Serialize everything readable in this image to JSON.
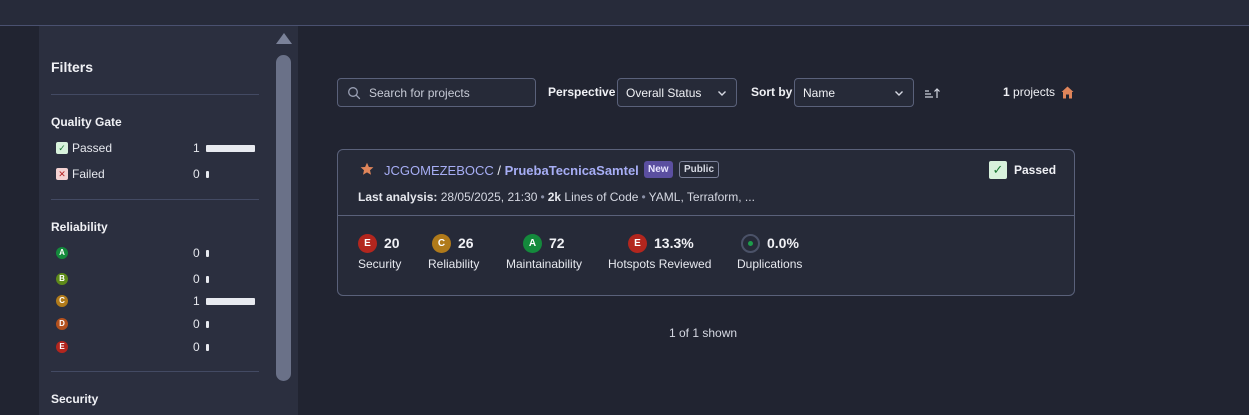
{
  "sidebar": {
    "title": "Filters",
    "quality_gate": {
      "title": "Quality Gate",
      "items": [
        {
          "label": "Passed",
          "count": "1",
          "fraction": 1.0
        },
        {
          "label": "Failed",
          "count": "0",
          "fraction": 0.0
        }
      ]
    },
    "reliability": {
      "title": "Reliability",
      "items": [
        {
          "rating": "A",
          "count": "0",
          "fraction": 0.0
        },
        {
          "rating": "B",
          "count": "0",
          "fraction": 0.0
        },
        {
          "rating": "C",
          "count": "1",
          "fraction": 1.0
        },
        {
          "rating": "D",
          "count": "0",
          "fraction": 0.0
        },
        {
          "rating": "E",
          "count": "0",
          "fraction": 0.0
        }
      ]
    },
    "security": {
      "title": "Security"
    }
  },
  "toolbar": {
    "search_placeholder": "Search for projects",
    "perspective_label": "Perspective",
    "perspective_value": "Overall Status",
    "sort_label": "Sort by",
    "sort_value": "Name",
    "sort_direction_icon": "sort-ascending-icon",
    "projects_count": "1",
    "projects_word": "projects"
  },
  "project": {
    "organization": "JCGOMEZEBOCC",
    "separator": " / ",
    "name": "PruebaTecnicaSamtel",
    "badge_new": "New",
    "badge_visibility": "Public",
    "quality_gate": "Passed",
    "last_analysis_label": "Last analysis:",
    "last_analysis_value": "28/05/2025, 21:30",
    "loc_value": "2k",
    "loc_label": "Lines of Code",
    "languages": "YAML, Terraform, ...",
    "metrics": [
      {
        "rating": "E",
        "value": "20",
        "label": "Security"
      },
      {
        "rating": "C",
        "value": "26",
        "label": "Reliability"
      },
      {
        "rating": "A",
        "value": "72",
        "label": "Maintainability"
      },
      {
        "rating": "E",
        "value": "13.3%",
        "label": "Hotspots Reviewed"
      },
      {
        "rating": "",
        "value": "0.0%",
        "label": "Duplications"
      }
    ]
  },
  "footer": {
    "shown_text": "1 of 1 shown"
  },
  "colors": {
    "accent": "#a7aef5",
    "background": "#212431",
    "rating_a": "#148a3c",
    "rating_c": "#b07a1a",
    "rating_e": "#b3261e"
  }
}
